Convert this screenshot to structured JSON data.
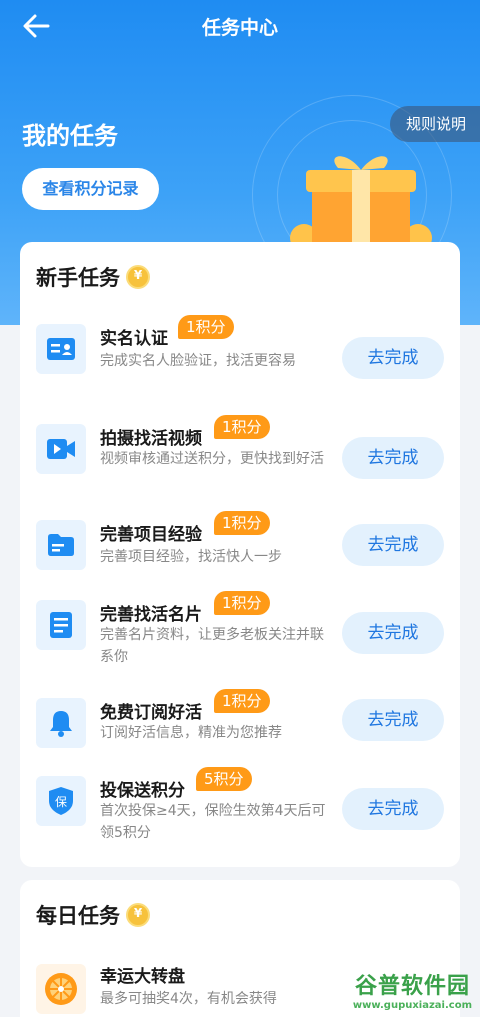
{
  "nav": {
    "title": "任务中心"
  },
  "header": {
    "my_task": "我的任务",
    "points_record_button": "查看积分记录",
    "rules_button": "规则说明"
  },
  "newbie": {
    "title": "新手任务",
    "tasks": [
      {
        "title": "实名认证",
        "points": "1积分",
        "desc": "完成实名人脸验证，找活更容易",
        "button": "去完成",
        "icon": "id-card-icon"
      },
      {
        "title": "拍摄找活视频",
        "points": "1积分",
        "desc": "视频审核通过送积分，更快找到好活",
        "button": "去完成",
        "icon": "video-camera-icon"
      },
      {
        "title": "完善项目经验",
        "points": "1积分",
        "desc": "完善项目经验，找活快人一步",
        "button": "去完成",
        "icon": "folder-icon"
      },
      {
        "title": "完善找活名片",
        "points": "1积分",
        "desc": "完善名片资料，让更多老板关注并联系你",
        "button": "去完成",
        "icon": "document-icon"
      },
      {
        "title": "免费订阅好活",
        "points": "1积分",
        "desc": "订阅好活信息，精准为您推荐",
        "button": "去完成",
        "icon": "bell-icon"
      },
      {
        "title": "投保送积分",
        "points": "5积分",
        "desc": "首次投保≥4天，保险生效第4天后可领5积分",
        "button": "去完成",
        "icon": "insurance-shield-icon"
      }
    ]
  },
  "daily": {
    "title": "每日任务",
    "tasks": [
      {
        "title": "幸运大转盘",
        "desc": "最多可抽奖4次，有机会获得",
        "icon": "lucky-wheel-icon"
      }
    ]
  },
  "watermark": {
    "main": "谷普软件园",
    "url": "www.gupuxiazai.com"
  },
  "colors": {
    "primary": "#1f8cf2",
    "badge": "#ff9a17",
    "button_bg": "#e3f1fd"
  }
}
